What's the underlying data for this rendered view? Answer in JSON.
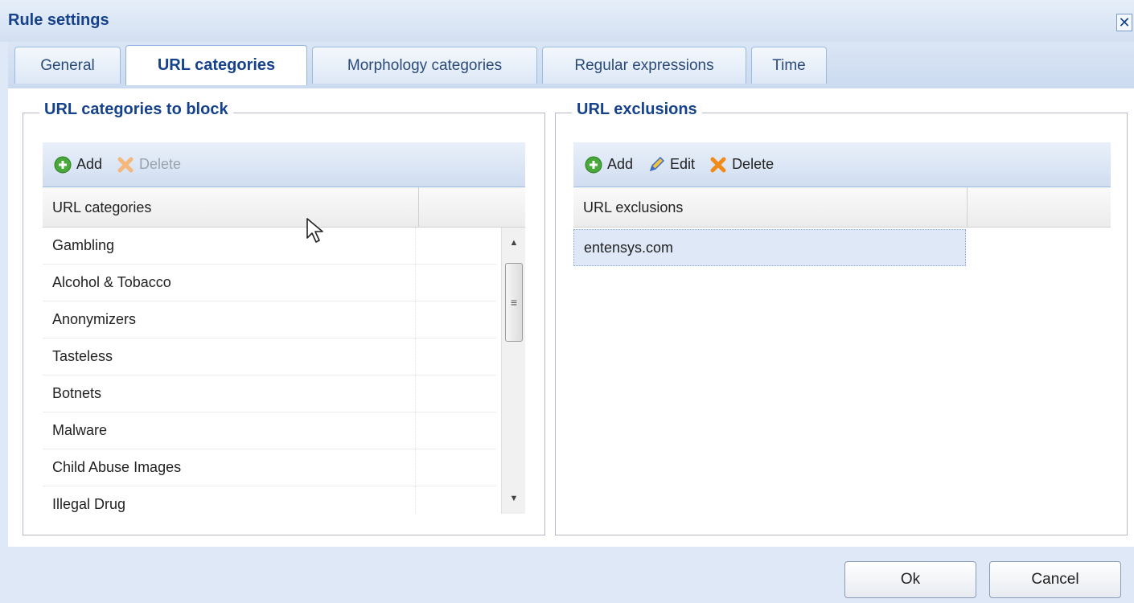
{
  "dialog": {
    "title": "Rule settings",
    "close_glyph": "✕"
  },
  "tabs": [
    {
      "label": "General",
      "active": false
    },
    {
      "label": "URL categories",
      "active": true
    },
    {
      "label": "Morphology categories",
      "active": false
    },
    {
      "label": "Regular expressions",
      "active": false
    },
    {
      "label": "Time",
      "active": false
    }
  ],
  "left_panel": {
    "legend": "URL categories to block",
    "toolbar": {
      "add_label": "Add",
      "delete_label": "Delete",
      "add_icon": "add-circle-icon",
      "delete_icon": "delete-x-icon"
    },
    "column_header": "URL categories",
    "rows": [
      "Gambling",
      "Alcohol & Tobacco",
      "Anonymizers",
      "Tasteless",
      "Botnets",
      "Malware",
      "Child Abuse Images",
      "Illegal Drug"
    ]
  },
  "right_panel": {
    "legend": "URL exclusions",
    "toolbar": {
      "add_label": "Add",
      "edit_label": "Edit",
      "delete_label": "Delete",
      "add_icon": "add-circle-icon",
      "edit_icon": "pencil-icon",
      "delete_icon": "delete-x-icon"
    },
    "column_header": "URL exclusions",
    "rows": [
      "entensys.com"
    ],
    "selected_row": 0
  },
  "footer": {
    "ok_label": "Ok",
    "cancel_label": "Cancel"
  },
  "colors": {
    "accent": "#15428b",
    "panel_bg": "#dfe8f6",
    "delete_orange": "#f28a1a",
    "add_green": "#49a83a"
  }
}
